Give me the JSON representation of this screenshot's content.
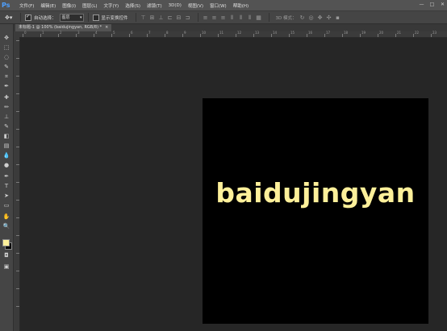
{
  "app": {
    "logo": "Ps"
  },
  "menu": [
    "文件(F)",
    "编辑(E)",
    "图像(I)",
    "图层(L)",
    "文字(Y)",
    "选择(S)",
    "滤镜(T)",
    "3D(D)",
    "视图(V)",
    "窗口(W)",
    "帮助(H)"
  ],
  "window_controls": {
    "minimize": "—",
    "maximize": "□",
    "close": "✕"
  },
  "options": {
    "auto_select_label": "自动选择：",
    "auto_select_checked": true,
    "auto_select_value": "图层",
    "show_transform_label": "显示变换控件",
    "show_transform_checked": false,
    "mode_label": "3D 模式："
  },
  "document": {
    "tab_title": "未标题-1 @ 100% (baidujingyan, RGB/8) *",
    "tab_close": "×",
    "text_layer": "baidujingyan",
    "text_color": "#fef09a",
    "canvas_color": "#000000"
  },
  "colors": {
    "foreground": "#fef09a",
    "background": "#000000"
  },
  "ruler_labels": [
    "0",
    "1",
    "2",
    "3",
    "4",
    "5",
    "6",
    "7",
    "8",
    "9",
    "10",
    "11",
    "12",
    "13",
    "14",
    "15",
    "16",
    "17",
    "18",
    "19",
    "20",
    "21",
    "22",
    "23"
  ]
}
